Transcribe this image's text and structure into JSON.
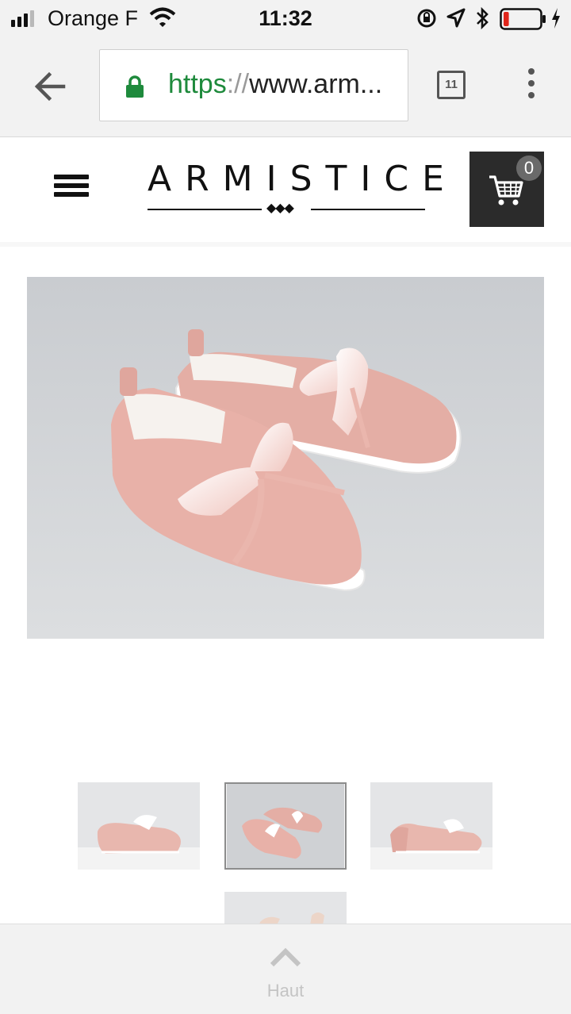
{
  "status_bar": {
    "carrier": "Orange F",
    "time": "11:32",
    "battery_level": 0.15,
    "signal_bars": 3,
    "icons": [
      "signal-icon",
      "wifi-icon",
      "rotation-lock-icon",
      "location-icon",
      "bluetooth-icon",
      "battery-icon",
      "charging-icon"
    ]
  },
  "browser": {
    "url_scheme": "https",
    "url_separator": "://",
    "url_rest": "www.arm...",
    "tab_count": "11",
    "icons": [
      "back-arrow-icon",
      "lock-icon",
      "more-vert-icon"
    ],
    "secure_color": "#1e8a3c"
  },
  "site": {
    "logo_text": "ARMISTICE",
    "logo_diamonds": "◆◆◆",
    "cart_count": "0",
    "cart_bg": "#2b2b2b",
    "icons": [
      "hamburger-menu-icon",
      "cart-icon"
    ]
  },
  "product": {
    "main_image_alt": "",
    "shoe_color": "#e8b1a8",
    "thumbnails": [
      {
        "id": "thumb-1",
        "active": false
      },
      {
        "id": "thumb-2",
        "active": true
      },
      {
        "id": "thumb-3",
        "active": false
      },
      {
        "id": "thumb-4",
        "active": false
      }
    ]
  },
  "footer": {
    "top_label": "Haut",
    "icons": [
      "chevron-up-icon"
    ]
  }
}
